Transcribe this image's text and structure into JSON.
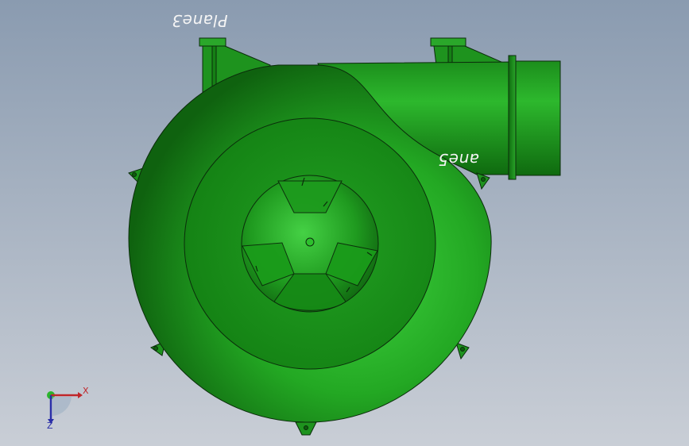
{
  "viewport": {
    "background_top": "#8a9bb0",
    "background_bottom": "#c9ced6"
  },
  "model": {
    "body_color": "#21a521",
    "body_dark": "#0d5e0d",
    "body_light": "#3fd23f",
    "edge_color": "#0b2c0b"
  },
  "labels": {
    "plane3": "Plane3",
    "plane5": "ane5"
  },
  "triad": {
    "x_label": "X",
    "z_label": "Z",
    "x_color": "#c0262a",
    "y_color": "#2bb52b",
    "z_color": "#2a2fa8"
  }
}
